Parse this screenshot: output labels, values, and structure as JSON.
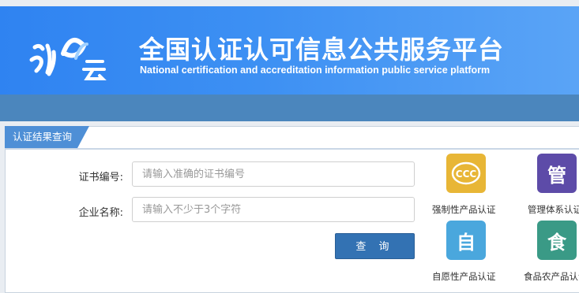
{
  "header": {
    "logo_text": "认证云",
    "title": "全国认证认可信息公共服务平台",
    "subtitle": "National certification and accreditation information public service platform"
  },
  "panel": {
    "tab_label": "认证结果查询",
    "cert_label": "证书编号:",
    "cert_placeholder": "请输入准确的证书编号",
    "company_label": "企业名称:",
    "company_placeholder": "请输入不少于3个字符",
    "query_button": "查 询"
  },
  "services": [
    {
      "label": "强制性产品认证",
      "icon": "ccc-icon",
      "glyph": "CCC",
      "color": "#e8b636"
    },
    {
      "label": "管理体系认证",
      "icon": "management-icon",
      "glyph": "管",
      "color": "#5d4ba8"
    },
    {
      "label": "自愿性产品认证",
      "icon": "voluntary-icon",
      "glyph": "自",
      "color": "#4aa7dd"
    },
    {
      "label": "食品农产品认证",
      "icon": "food-icon",
      "glyph": "食",
      "color": "#3a9a86"
    }
  ]
}
